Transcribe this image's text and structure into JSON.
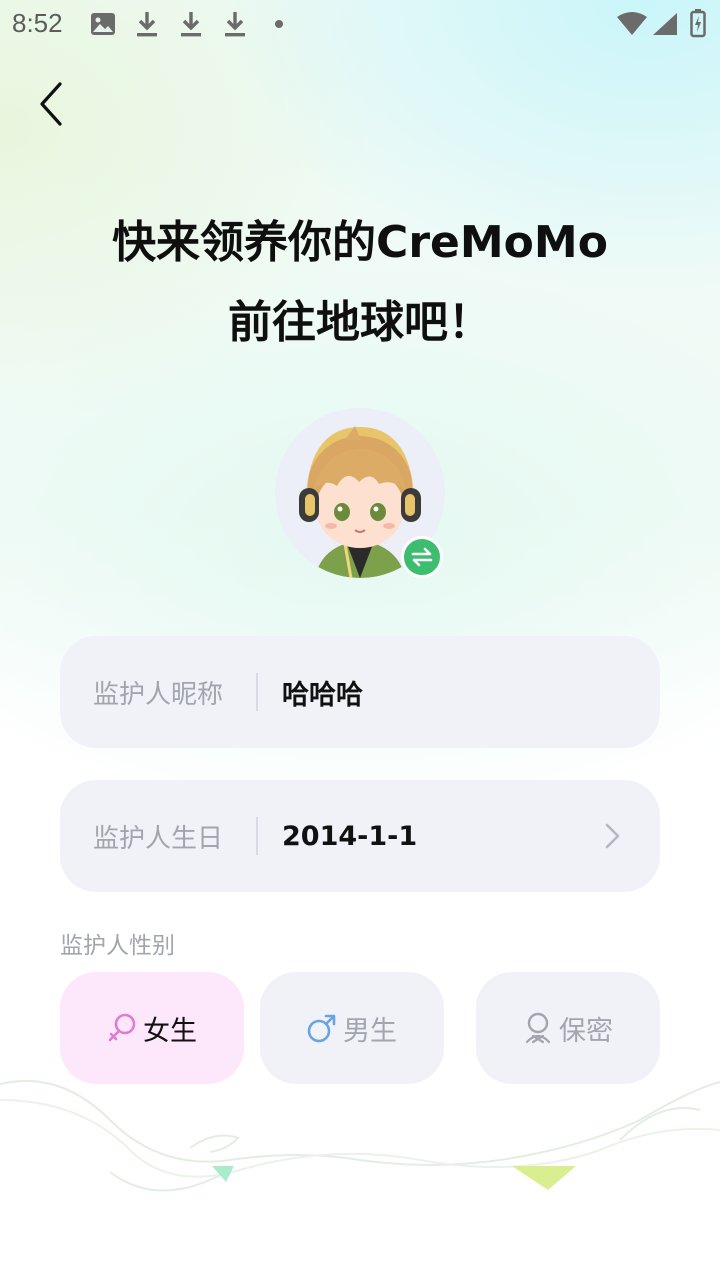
{
  "status_bar": {
    "time": "8:52",
    "icons": [
      "image-icon",
      "download-icon",
      "download-icon",
      "download-icon",
      "dot-icon",
      "wifi-icon",
      "signal-icon",
      "battery-charging-icon"
    ]
  },
  "header": {
    "line1": "快来领养你的CreMoMo",
    "line2": "前往地球吧！"
  },
  "form": {
    "nickname_label": "监护人昵称",
    "nickname_value": "哈哈哈",
    "birthday_label": "监护人生日",
    "birthday_value": "2014-1-1",
    "gender_label": "监护人性别",
    "gender_options": [
      {
        "label": "女生",
        "icon": "female-icon",
        "selected": true
      },
      {
        "label": "男生",
        "icon": "male-icon",
        "selected": false
      },
      {
        "label": "保密",
        "icon": "secret-person-icon",
        "selected": false
      }
    ]
  },
  "colors": {
    "accent_green": "#3dbd6f",
    "female_selected_bg": "#fde7fb",
    "field_bg": "#f0f2f8",
    "female_icon": "#e07bd4",
    "male_icon": "#6aa4df"
  }
}
